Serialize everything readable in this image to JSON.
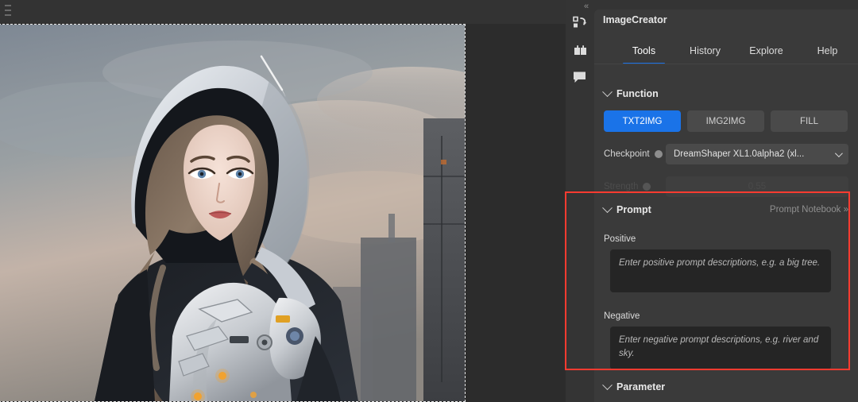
{
  "window": {
    "panel_collapse_icon": "collapse-left-chevrons",
    "panel_menu_icon": "hamburger-menu-icon"
  },
  "canvas": {
    "topbar_icon": "canvas-handle-icon",
    "artwork_alt": "AI generated hooded woman in white mech armor against a cloudy futuristic city skyline",
    "selection_style": "marching-ants-dashed"
  },
  "icon_rail": [
    {
      "name": "layers-undo-icon",
      "glyph": "↺"
    },
    {
      "name": "book-icon",
      "glyph": "▤"
    },
    {
      "name": "chat-bubble-icon",
      "glyph": "▭"
    }
  ],
  "panel": {
    "title": "ImageCreator",
    "tabs": [
      {
        "label": "Tools",
        "active": true
      },
      {
        "label": "History",
        "active": false
      },
      {
        "label": "Explore",
        "active": false
      },
      {
        "label": "Help",
        "active": false
      }
    ]
  },
  "function": {
    "section_title": "Function",
    "modes": [
      {
        "label": "TXT2IMG",
        "active": true
      },
      {
        "label": "IMG2IMG",
        "active": false
      },
      {
        "label": "FILL",
        "active": false
      }
    ],
    "checkpoint_label": "Checkpoint",
    "checkpoint_value": "DreamShaper XL1.0alpha2 (xl...",
    "strength_label": "Strength",
    "strength_value": "0.55"
  },
  "prompt": {
    "section_title": "Prompt",
    "notebook_link": "Prompt Notebook »",
    "positive_label": "Positive",
    "positive_placeholder": "Enter positive prompt descriptions, e.g. a big tree.",
    "negative_label": "Negative",
    "negative_placeholder": "Enter negative prompt descriptions, e.g. river and sky."
  },
  "parameter": {
    "section_title": "Parameter"
  },
  "annotation": {
    "highlight_color": "#ff3b30",
    "accent_color": "#1a73e8"
  }
}
